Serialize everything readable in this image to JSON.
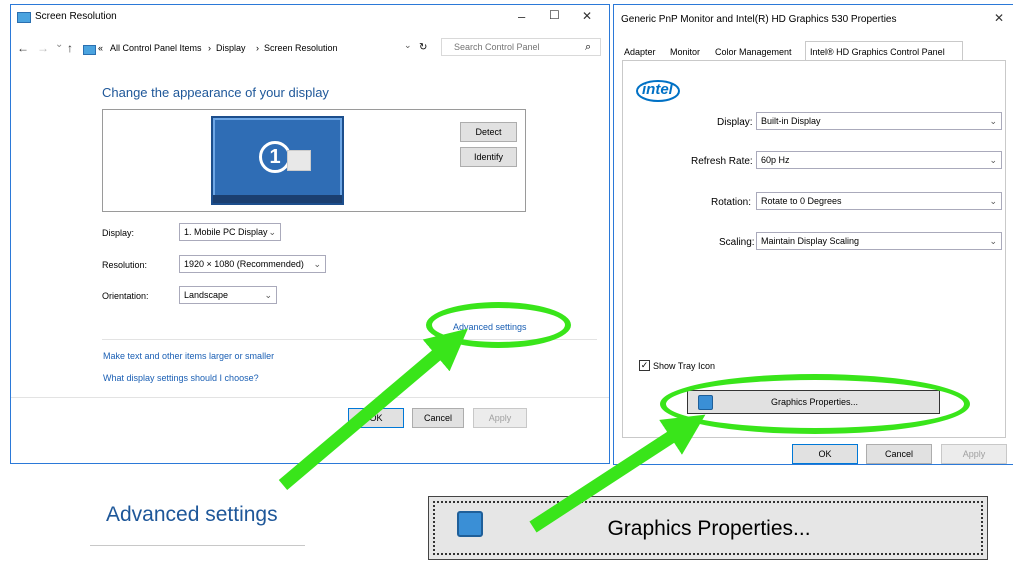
{
  "left_window": {
    "title": "Screen Resolution",
    "controls": {
      "minimize": "–",
      "maximize": "☐",
      "close": "✕"
    },
    "address": {
      "back": "←",
      "forward": "→",
      "recent": "⌄",
      "up": "↑",
      "overflow": "«",
      "crumb1": "All Control Panel Items",
      "sep": "›",
      "crumb2": "Display",
      "crumb3": "Screen Resolution",
      "dropdown": "⌄",
      "refresh": "↻",
      "search_placeholder": "Search Control Panel",
      "search_icon": "⌕"
    },
    "heading": "Change the appearance of your display",
    "monitor_number": "1",
    "detect_label": "Detect",
    "identify_label": "Identify",
    "display_label": "Display:",
    "display_value": "1. Mobile PC Display",
    "resolution_label": "Resolution:",
    "resolution_value": "1920 × 1080 (Recommended)",
    "orientation_label": "Orientation:",
    "orientation_value": "Landscape",
    "advanced_link": "Advanced settings",
    "link_text_size": "Make text and other items larger or smaller",
    "link_what": "What display settings should I choose?",
    "ok_label": "OK",
    "cancel_label": "Cancel",
    "apply_label": "Apply"
  },
  "right_window": {
    "title": "Generic PnP Monitor and Intel(R) HD Graphics 530 Properties",
    "close": "✕",
    "tabs": [
      "Adapter",
      "Monitor",
      "Color Management",
      "Intel® HD Graphics Control Panel"
    ],
    "logo": "intel",
    "display_label": "Display:",
    "display_value": "Built-in Display",
    "refresh_label": "Refresh Rate:",
    "refresh_value": "60p Hz",
    "rotation_label": "Rotation:",
    "rotation_value": "Rotate to 0 Degrees",
    "scaling_label": "Scaling:",
    "scaling_value": "Maintain Display Scaling",
    "tray_label": "Show Tray Icon",
    "tray_checked": "✓",
    "graphics_button": "Graphics Properties...",
    "ok_label": "OK",
    "cancel_label": "Cancel",
    "apply_label": "Apply"
  },
  "zoom": {
    "advanced_settings": "Advanced settings",
    "graphics_properties": "Graphics Properties..."
  },
  "colors": {
    "window_border": "#2b79d8",
    "highlight": "#39e51a",
    "heading_blue": "#1e5799",
    "link_blue": "#1a5fb4",
    "intel_blue": "#0071c5"
  },
  "icons": {
    "chevron": "⌄",
    "checkbox": "✓"
  }
}
